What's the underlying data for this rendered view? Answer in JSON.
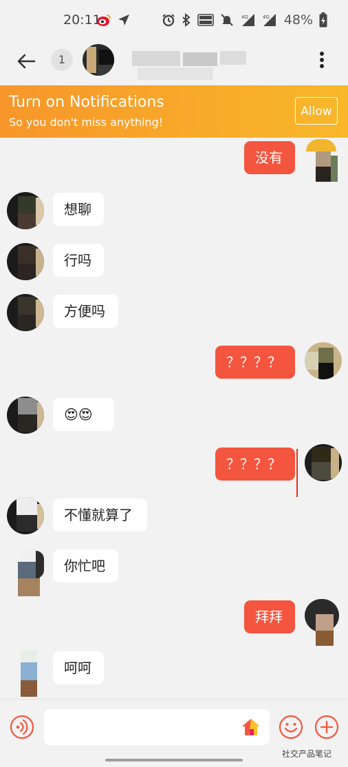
{
  "status_bar": {
    "time": "20:11",
    "battery": "48%"
  },
  "header": {
    "badge_count": "1"
  },
  "notification": {
    "title": "Turn on Notifications",
    "subtitle": "So you don't miss anything!",
    "allow_label": "Allow",
    "colors": {
      "start": "#f7962a",
      "end": "#f8b82a"
    }
  },
  "messages": [
    {
      "direction": "outgoing",
      "text": "没有"
    },
    {
      "direction": "incoming",
      "text": "想聊"
    },
    {
      "direction": "incoming",
      "text": "行吗"
    },
    {
      "direction": "incoming",
      "text": "方便吗"
    },
    {
      "direction": "outgoing",
      "text": "？？？？"
    },
    {
      "direction": "incoming",
      "text": "😍😍"
    },
    {
      "direction": "outgoing",
      "text": "？？？？"
    },
    {
      "direction": "incoming",
      "text": "不懂就算了"
    },
    {
      "direction": "incoming",
      "text": "你忙吧"
    },
    {
      "direction": "outgoing",
      "text": "拜拜"
    },
    {
      "direction": "incoming",
      "text": "呵呵"
    }
  ],
  "colors": {
    "outgoing_bubble": "#f4553f",
    "incoming_bubble": "#ffffff",
    "background": "#f2f2f2"
  },
  "composer": {
    "placeholder": "",
    "watermark": "社交产品笔记"
  },
  "icons": [
    "back-arrow-icon",
    "more-vertical-icon",
    "voice-icon",
    "home-icon",
    "emoji-icon",
    "plus-icon"
  ]
}
